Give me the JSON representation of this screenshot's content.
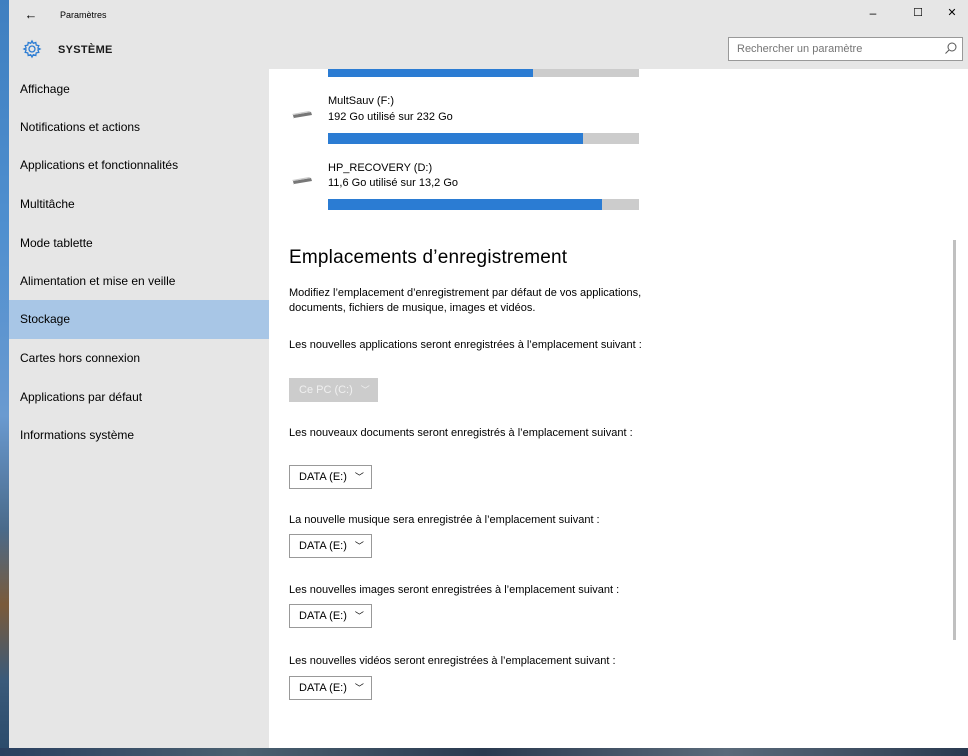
{
  "window": {
    "title": "Paramètres",
    "back_glyph": "←",
    "minimize_glyph": "–",
    "maximize_glyph": "☐",
    "close_glyph": "✕"
  },
  "header": {
    "heading": "SYSTÈME",
    "icon": "gear-icon",
    "search_placeholder": "Rechercher un paramètre"
  },
  "sidebar": {
    "items": [
      {
        "label": "Affichage",
        "selected": false
      },
      {
        "label": "Notifications et actions",
        "selected": false
      },
      {
        "label": "Applications et fonctionnalités",
        "selected": false
      },
      {
        "label": "Multitâche",
        "selected": false
      },
      {
        "label": "Mode tablette",
        "selected": false
      },
      {
        "label": "Alimentation et mise en veille",
        "selected": false
      },
      {
        "label": "Stockage",
        "selected": true
      },
      {
        "label": "Cartes hors connexion",
        "selected": false
      },
      {
        "label": "Applications par défaut",
        "selected": false
      },
      {
        "label": "Informations système",
        "selected": false
      }
    ]
  },
  "drives": [
    {
      "name": "",
      "usage": "",
      "fraction": 0.66
    },
    {
      "name": "MultSauv (F:)",
      "usage": "192 Go utilisé sur 232 Go",
      "fraction": 0.82
    },
    {
      "name": "HP_RECOVERY (D:)",
      "usage": "11,6 Go utilisé sur 13,2 Go",
      "fraction": 0.88
    }
  ],
  "save_locations": {
    "title": "Emplacements d’enregistrement",
    "description": "Modifiez l’emplacement d’enregistrement par défaut de vos applications, documents, fichiers de musique, images et vidéos.",
    "apps_label": "Les nouvelles applications seront enregistrées à l’emplacement suivant :",
    "apps_value": "Ce PC (C:)",
    "docs_label": "Les nouveaux documents seront enregistrés à l’emplacement suivant :",
    "docs_value": "DATA (E:)",
    "music_label": "La nouvelle musique sera enregistrée à l’emplacement suivant :",
    "music_value": "DATA (E:)",
    "images_label": "Les nouvelles images seront enregistrées à l’emplacement suivant :",
    "images_value": "DATA (E:)",
    "videos_label": "Les nouvelles vidéos seront enregistrées à l’emplacement suivant :",
    "videos_value": "DATA (E:)"
  },
  "colors": {
    "accent": "#2b7cd3",
    "selected_nav": "#a8c6e6",
    "sidebar_bg": "#e6e6e6"
  }
}
